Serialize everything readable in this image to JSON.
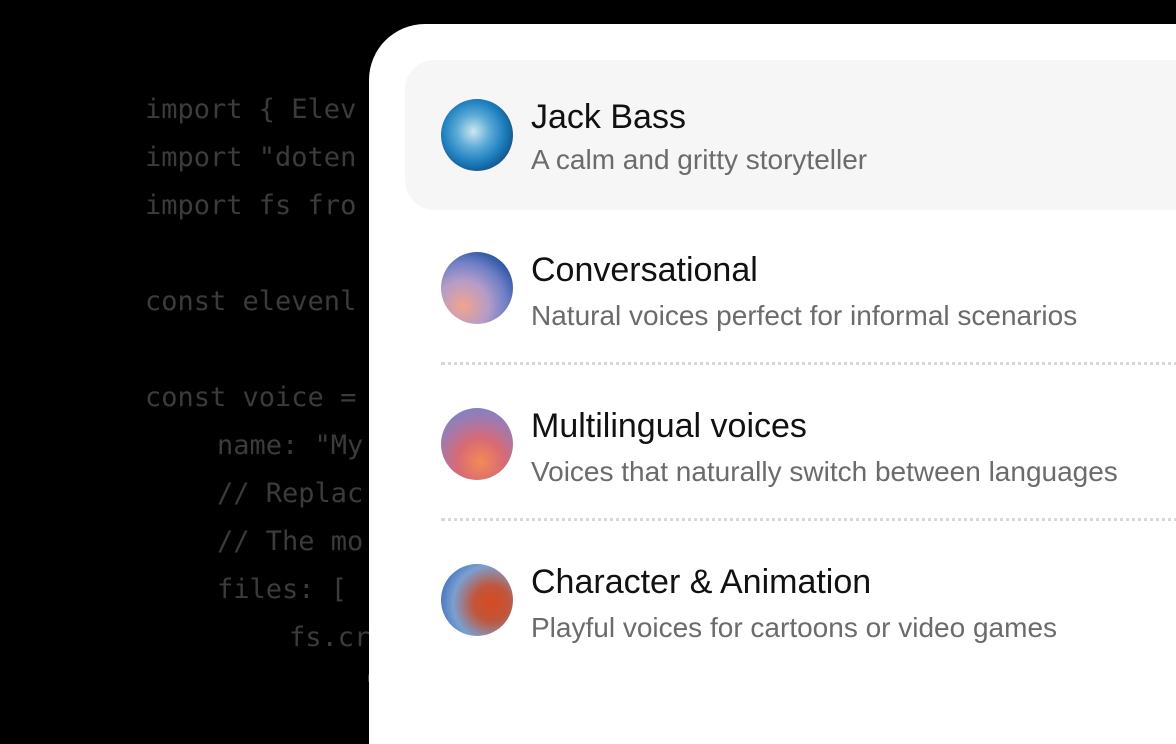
{
  "code_lines": [
    "import { Elev",
    "import \"doten",
    "import fs fro",
    "const elevenl",
    "const voice =",
    "name: \"My",
    "// Replac",
    "// The mo",
    "files: [",
    "fs.cr",
    "'"
  ],
  "voices": [
    {
      "title": "Jack Bass",
      "subtitle": "A calm and gritty storyteller"
    },
    {
      "title": "Conversational",
      "subtitle": "Natural voices perfect for informal scenarios"
    },
    {
      "title": "Multilingual voices",
      "subtitle": "Voices that naturally switch between languages"
    },
    {
      "title": "Character & Animation",
      "subtitle": "Playful voices for cartoons or video games"
    }
  ],
  "colors": {
    "background": "#000000",
    "code_text": "#3b3b3b",
    "panel": "#ffffff",
    "selected_item": "#f7f6f6",
    "title_text": "#111111",
    "subtitle_text": "#6b6b6b"
  }
}
